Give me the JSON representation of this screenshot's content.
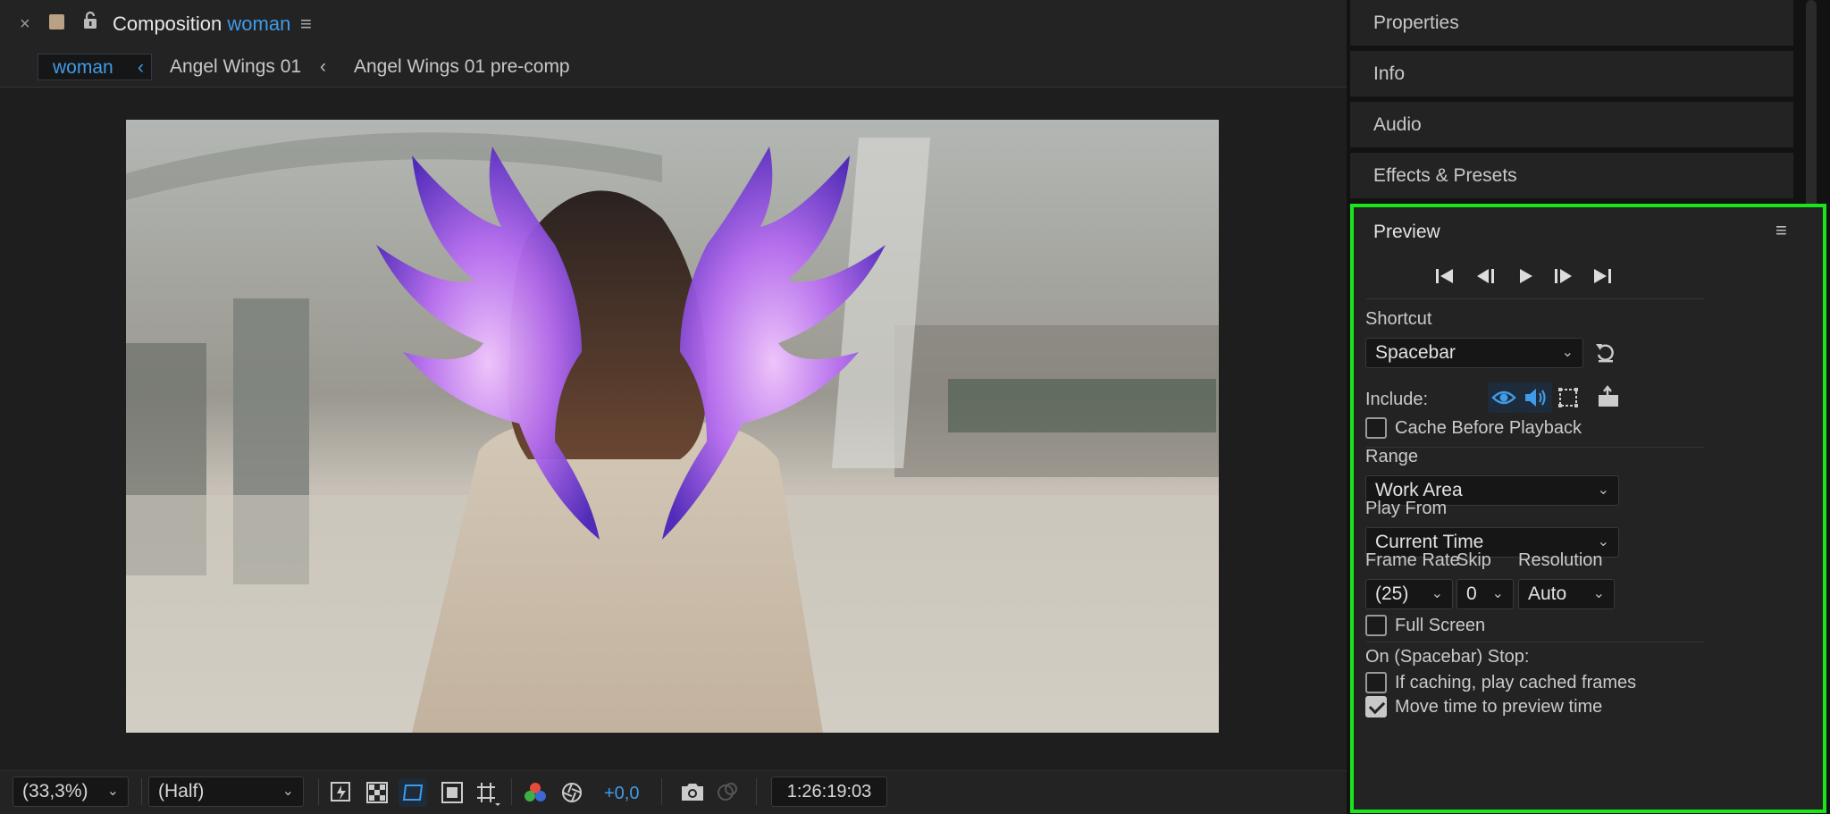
{
  "composition": {
    "title_prefix": "Composition",
    "title_name": "woman",
    "breadcrumb": [
      "woman",
      "Angel Wings 01",
      "Angel Wings 01 pre-comp"
    ],
    "footer": {
      "zoom": "(33,3%)",
      "resolution": "(Half)",
      "exposure": "+0,0",
      "timecode": "1:26:19:03"
    },
    "colors": {
      "accent": "#3f9be8",
      "label_swatch": "#b9a184"
    }
  },
  "panels": {
    "tabs": [
      "Properties",
      "Info",
      "Audio",
      "Effects & Presets"
    ]
  },
  "preview": {
    "title": "Preview",
    "highlight_color": "#19e51a",
    "shortcut_label": "Shortcut",
    "shortcut_value": "Spacebar",
    "include_label": "Include:",
    "include_video": true,
    "include_audio": true,
    "cache_before_playback_label": "Cache Before Playback",
    "cache_before_playback": false,
    "range_label": "Range",
    "range_value": "Work Area",
    "play_from_label": "Play From",
    "play_from_value": "Current Time",
    "frame_rate_label": "Frame Rate",
    "frame_rate_value": "(25)",
    "skip_label": "Skip",
    "skip_value": "0",
    "resolution_label": "Resolution",
    "resolution_value": "Auto",
    "full_screen_label": "Full Screen",
    "full_screen": false,
    "on_stop_label": "On (Spacebar) Stop:",
    "if_caching_label": "If caching, play cached frames",
    "if_caching": false,
    "move_time_label": "Move time to preview time",
    "move_time": true
  }
}
